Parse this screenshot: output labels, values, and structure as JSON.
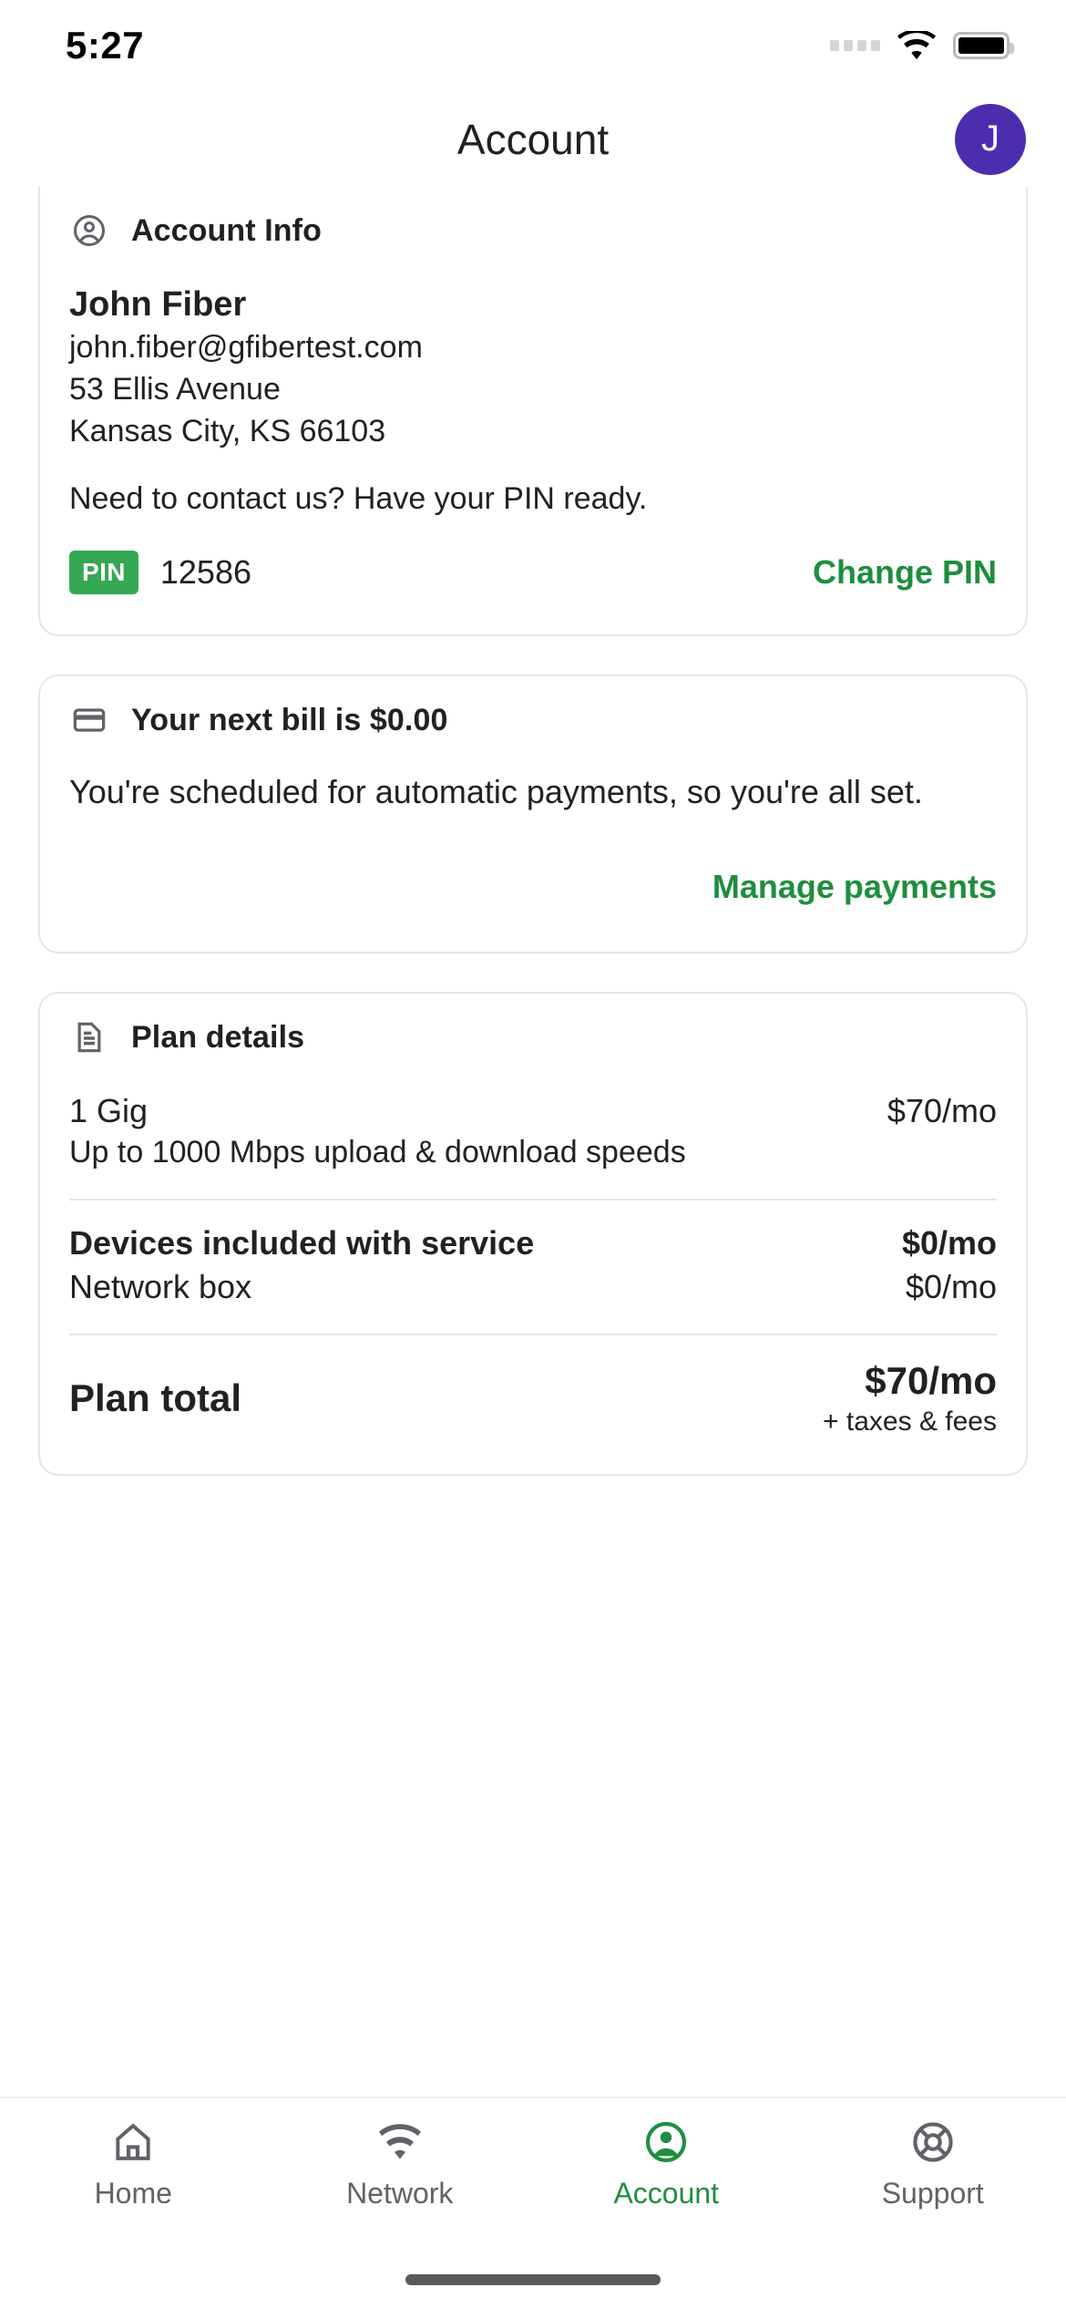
{
  "status_bar": {
    "time": "5:27",
    "signal_icon": "signal-dots-icon",
    "wifi_icon": "wifi-icon",
    "battery_icon": "battery-full-icon"
  },
  "header": {
    "title": "Account",
    "avatar_initial": "J",
    "avatar_color": "#4b2ead"
  },
  "colors": {
    "accent_green": "#1e8e3e",
    "badge_green": "#34a853",
    "icon_gray": "#5f6368",
    "text": "#202124",
    "card_border": "#e3e5e7"
  },
  "account_info_card": {
    "icon": "account-circle-icon",
    "title": "Account Info",
    "name": "John Fiber",
    "email": "john.fiber@gfibertest.com",
    "address_line1": "53 Ellis Avenue",
    "address_line2": "Kansas City, KS 66103",
    "note": "Need to contact us? Have your PIN ready.",
    "pin_badge_label": "PIN",
    "pin_value": "12586",
    "change_pin_label": "Change PIN"
  },
  "billing_card": {
    "icon": "credit-card-icon",
    "title": "Your next bill is $0.00",
    "body": "You're scheduled for automatic payments, so you're all set.",
    "manage_label": "Manage payments"
  },
  "plan_card": {
    "icon": "document-icon",
    "title": "Plan details",
    "plan_name": "1 Gig",
    "plan_price": "$70/mo",
    "plan_desc": "Up to 1000 Mbps upload & download speeds",
    "devices_label": "Devices included with service",
    "devices_price": "$0/mo",
    "device_name": "Network box",
    "device_price": "$0/mo",
    "total_label": "Plan total",
    "total_amount": "$70/mo",
    "total_note": "+ taxes & fees"
  },
  "tabbar": {
    "items": [
      {
        "label": "Home",
        "icon": "home-icon",
        "active": false
      },
      {
        "label": "Network",
        "icon": "wifi-icon",
        "active": false
      },
      {
        "label": "Account",
        "icon": "account-circle-icon",
        "active": true
      },
      {
        "label": "Support",
        "icon": "lifebuoy-icon",
        "active": false
      }
    ]
  }
}
